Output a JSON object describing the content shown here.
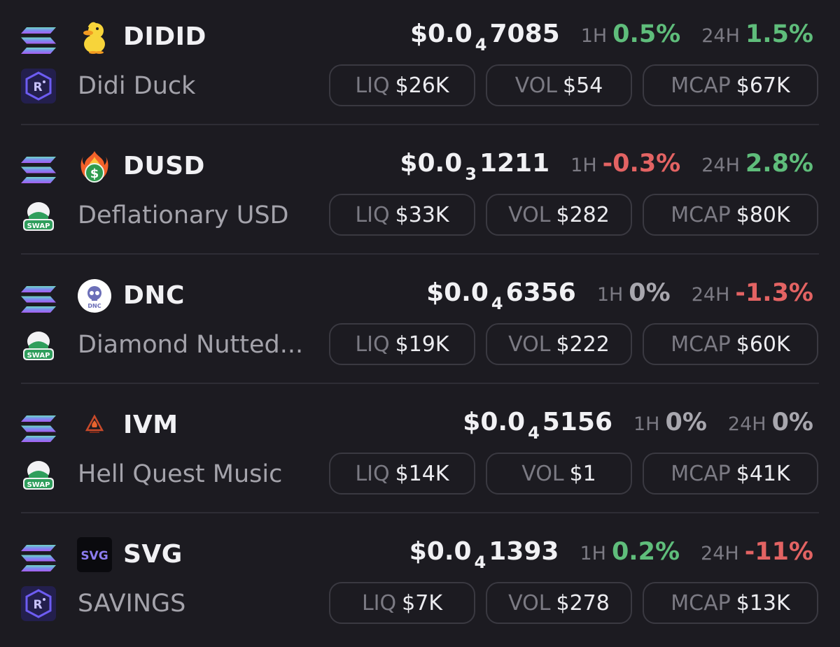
{
  "tokens": [
    {
      "symbol": "DIDID",
      "name": "Didi Duck",
      "chain_icon": "solana-icon",
      "dex_icon": "raydium-icon",
      "token_icon": "duck-icon",
      "price_prefix": "$0.0",
      "price_zeros": "4",
      "price_digits": "7085",
      "h1_label": "1H",
      "h1_change": "0.5%",
      "h1_trend": "pos",
      "h24_label": "24H",
      "h24_change": "1.5%",
      "h24_trend": "pos",
      "liq_label": "LIQ",
      "liq": "$26K",
      "vol_label": "VOL",
      "vol": "$54",
      "mcap_label": "MCAP",
      "mcap": "$67K"
    },
    {
      "symbol": "DUSD",
      "name": "Deflationary USD",
      "chain_icon": "solana-icon",
      "dex_icon": "swap-icon",
      "token_icon": "flaming-dollar-icon",
      "price_prefix": "$0.0",
      "price_zeros": "3",
      "price_digits": "1211",
      "h1_label": "1H",
      "h1_change": "-0.3%",
      "h1_trend": "neg",
      "h24_label": "24H",
      "h24_change": "2.8%",
      "h24_trend": "pos",
      "liq_label": "LIQ",
      "liq": "$33K",
      "vol_label": "VOL",
      "vol": "$282",
      "mcap_label": "MCAP",
      "mcap": "$80K"
    },
    {
      "symbol": "DNC",
      "name": "Diamond Nutted...",
      "chain_icon": "solana-icon",
      "dex_icon": "swap-icon",
      "token_icon": "skull-icon",
      "token_icon_text": "DNC",
      "price_prefix": "$0.0",
      "price_zeros": "4",
      "price_digits": "6356",
      "h1_label": "1H",
      "h1_change": "0%",
      "h1_trend": "neu",
      "h24_label": "24H",
      "h24_change": "-1.3%",
      "h24_trend": "neg",
      "liq_label": "LIQ",
      "liq": "$19K",
      "vol_label": "VOL",
      "vol": "$222",
      "mcap_label": "MCAP",
      "mcap": "$60K"
    },
    {
      "symbol": "IVM",
      "name": "Hell Quest Music",
      "chain_icon": "solana-icon",
      "dex_icon": "swap-icon",
      "token_icon": "fire-emblem-icon",
      "price_prefix": "$0.0",
      "price_zeros": "4",
      "price_digits": "5156",
      "h1_label": "1H",
      "h1_change": "0%",
      "h1_trend": "neu",
      "h24_label": "24H",
      "h24_change": "0%",
      "h24_trend": "neu",
      "liq_label": "LIQ",
      "liq": "$14K",
      "vol_label": "VOL",
      "vol": "$1",
      "mcap_label": "MCAP",
      "mcap": "$41K"
    },
    {
      "symbol": "SVG",
      "name": "SAVINGS",
      "chain_icon": "solana-icon",
      "dex_icon": "raydium-icon",
      "token_icon": "svg-logo-icon",
      "token_icon_text": "SVG",
      "price_prefix": "$0.0",
      "price_zeros": "4",
      "price_digits": "1393",
      "h1_label": "1H",
      "h1_change": "0.2%",
      "h1_trend": "pos",
      "h24_label": "24H",
      "h24_change": "-11%",
      "h24_trend": "neg",
      "liq_label": "LIQ",
      "liq": "$7K",
      "vol_label": "VOL",
      "vol": "$278",
      "mcap_label": "MCAP",
      "mcap": "$13K"
    }
  ],
  "dex_swap_label": "SWAP",
  "dex_raydium_label": "R",
  "colors": {
    "background": "#1c1b21",
    "positive": "#5fbd7b",
    "negative": "#e36363",
    "neutral": "#a8a7ae",
    "pill_border": "#3a3941"
  }
}
